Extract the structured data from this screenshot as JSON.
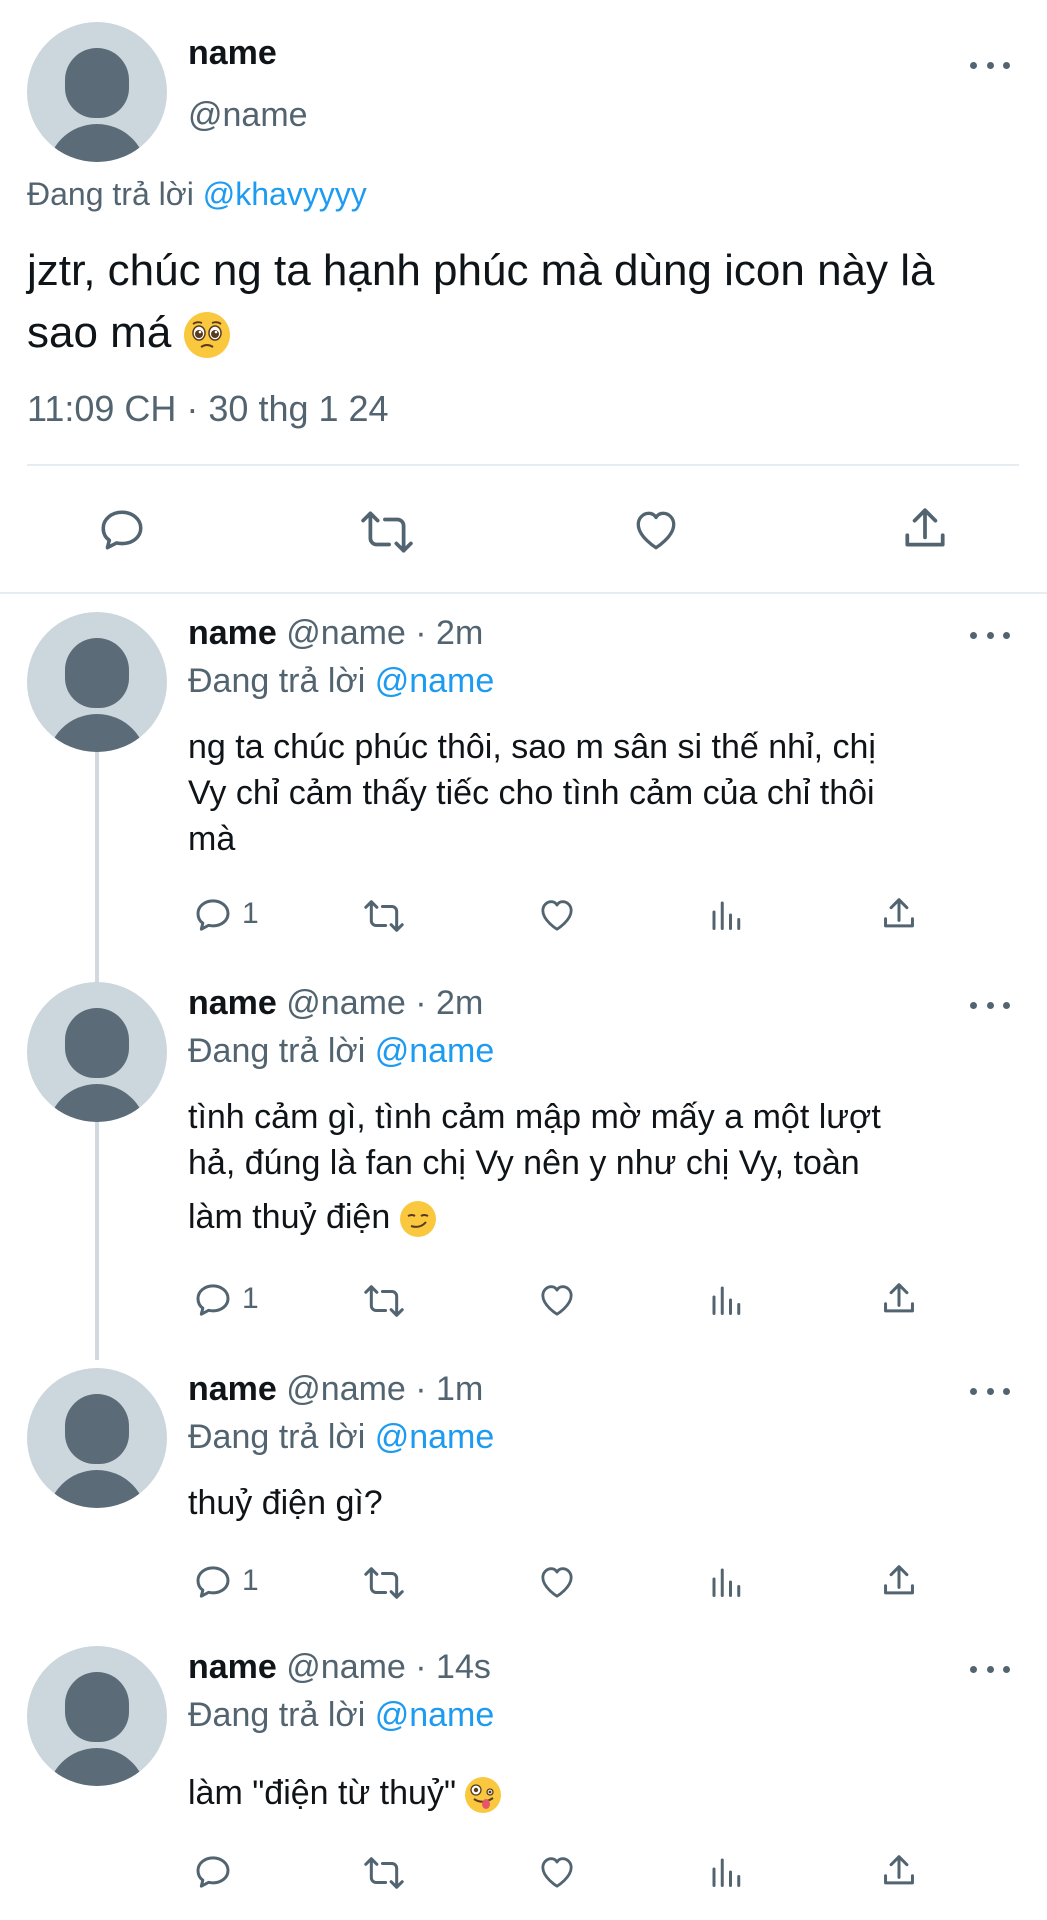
{
  "main_tweet": {
    "display_name": "name",
    "handle": "@name",
    "replying_prefix": "Đang trả lời",
    "replying_to": "@khavyyyy",
    "text": "jztr, chúc ng ta hạnh phúc mà dùng icon này là sao má",
    "emoji_icon": "pleading-face",
    "timestamp": "11:09 CH · 30 thg 1 24",
    "actions": [
      "reply-icon",
      "retweet-icon",
      "like-icon",
      "share-icon"
    ]
  },
  "replies": [
    {
      "display_name": "name",
      "handle_time": "@name · 2m",
      "replying_prefix": "Đang trả lời",
      "replying_to": "@name",
      "text_lines": [
        "ng ta chúc phúc thôi, sao m sân si thế nhỉ, chị",
        "Vy chỉ cảm thấy tiếc cho tình cảm của chỉ thôi",
        "mà"
      ],
      "reply_count": "1"
    },
    {
      "display_name": "name",
      "handle_time": "@name · 2m",
      "replying_prefix": "Đang trả lời",
      "replying_to": "@name",
      "text_lines": [
        "tình cảm gì, tình cảm mập mờ mấy a một lượt",
        "hả, đúng là fan chị Vy nên y như chị Vy, toàn",
        "làm thuỷ điện"
      ],
      "emoji_icon": "smirking-face",
      "reply_count": "1"
    },
    {
      "display_name": "name",
      "handle_time": "@name · 1m",
      "replying_prefix": "Đang trả lời",
      "replying_to": "@name",
      "text_lines": [
        "thuỷ điện gì?"
      ],
      "reply_count": "1"
    },
    {
      "display_name": "name",
      "handle_time": "@name · 14s",
      "replying_prefix": "Đang trả lời",
      "replying_to": "@name",
      "text_lines": [
        "làm \"điện từ thuỷ\""
      ],
      "emoji_icon": "zany-face",
      "reply_count": ""
    }
  ],
  "colors": {
    "text": "#0f1419",
    "secondary": "#536471",
    "link": "#1d9bf0",
    "divider": "#e6ecf0",
    "avatar_bg": "#ccd6dd"
  }
}
